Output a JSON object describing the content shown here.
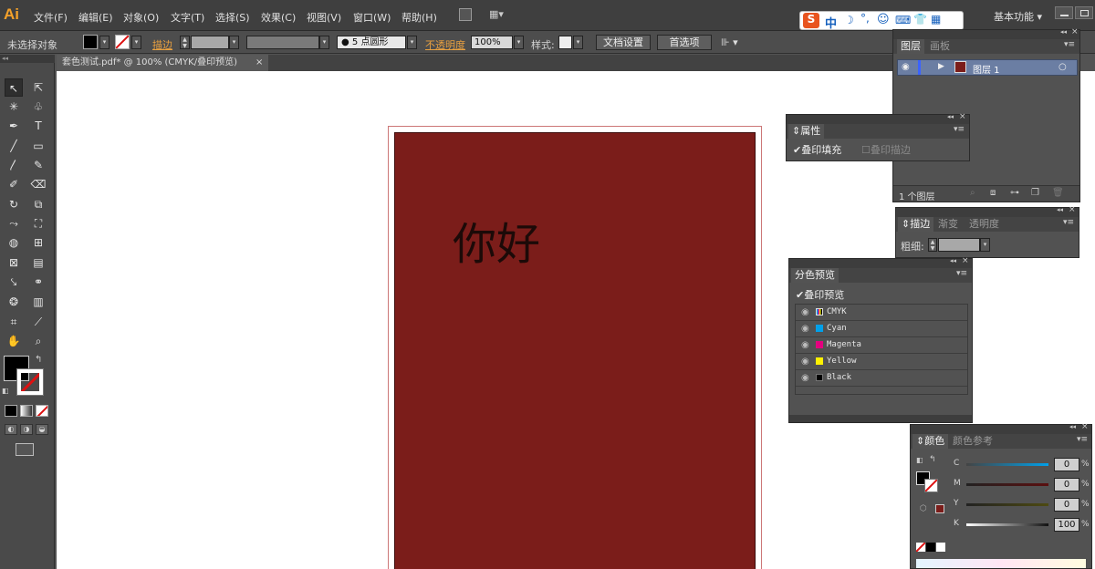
{
  "app": {
    "logo": "Ai"
  },
  "menu": [
    "文件(F)",
    "编辑(E)",
    "对象(O)",
    "文字(T)",
    "选择(S)",
    "效果(C)",
    "视图(V)",
    "窗口(W)",
    "帮助(H)"
  ],
  "workspace": {
    "label": "基本功能"
  },
  "control": {
    "selection": "未选择对象",
    "stroke_label": "描边",
    "brush": "5 点圆形",
    "opacity_label": "不透明度",
    "opacity": "100%",
    "style_label": "样式",
    "doc_setup": "文档设置",
    "prefs": "首选项"
  },
  "document": {
    "tab": "套色测试.pdf* @ 100% (CMYK/叠印预览)",
    "close": "×",
    "text": "你好",
    "art_color": "#7b1d1a"
  },
  "ime": {
    "chars": [
      "S",
      "中",
      "☽",
      "°,",
      "☺",
      "⌨",
      "👕",
      "▦"
    ]
  },
  "layers": {
    "tabs": [
      "图层",
      "画板"
    ],
    "layer_name": "图层 1",
    "count": "1 个图层"
  },
  "attributes": {
    "title": "属性",
    "overprint_fill": "叠印填充",
    "overprint_stroke": "叠印描边"
  },
  "stroke": {
    "tabs": [
      "描边",
      "渐变",
      "透明度"
    ],
    "weight_label": "粗细"
  },
  "separations": {
    "title": "分色预览",
    "overprint_preview": "叠印预览",
    "inks": [
      {
        "name": "CMYK",
        "color": "#6fa8dc"
      },
      {
        "name": "Cyan",
        "color": "#00a0e9"
      },
      {
        "name": "Magenta",
        "color": "#e4007f"
      },
      {
        "name": "Yellow",
        "color": "#fff100"
      },
      {
        "name": "Black",
        "color": "#000000"
      }
    ]
  },
  "color": {
    "tabs": [
      "颜色",
      "颜色参考"
    ],
    "channels": [
      {
        "label": "C",
        "value": "0",
        "unit": "%"
      },
      {
        "label": "M",
        "value": "0",
        "unit": "%"
      },
      {
        "label": "Y",
        "value": "0",
        "unit": "%"
      },
      {
        "label": "K",
        "value": "100",
        "unit": "%"
      }
    ]
  },
  "panel_controls": {
    "collapse": "◂◂",
    "close": "×",
    "menu": "▾≡"
  }
}
